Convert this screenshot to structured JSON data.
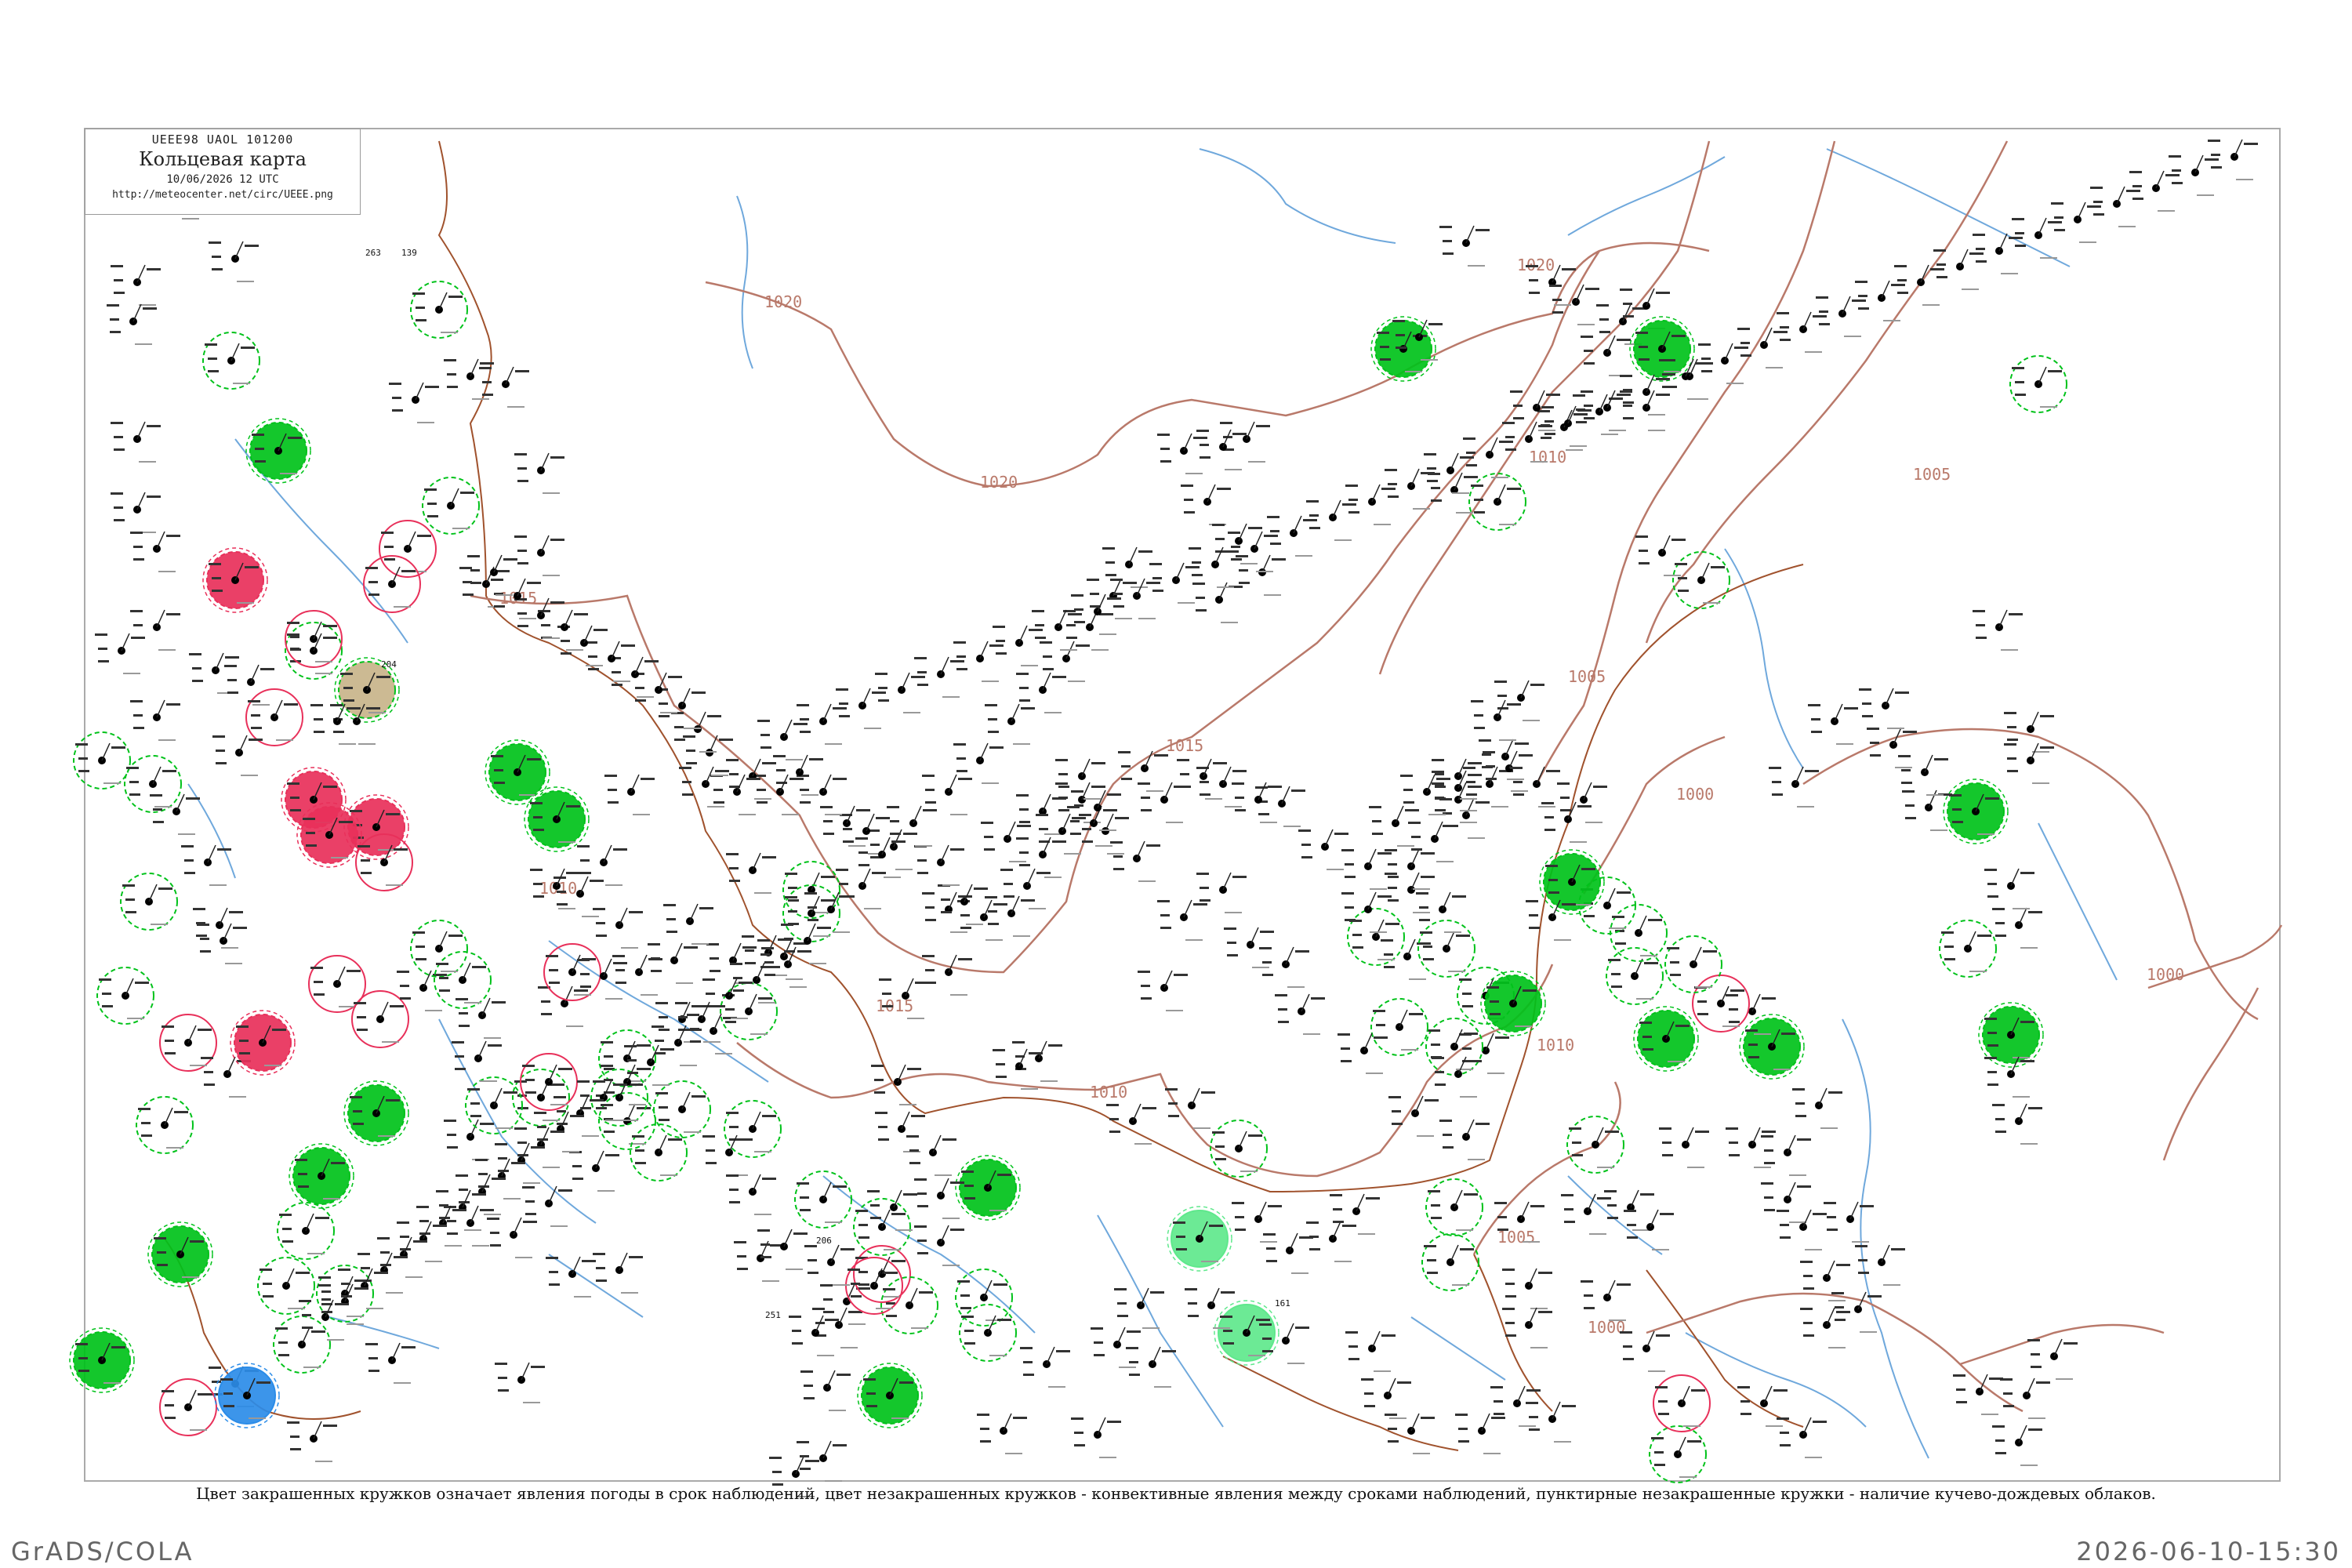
{
  "header": {
    "code": "UEEE98  UAOL  101200",
    "title": "Кольцевая карта",
    "time": "10/06/2026 12 UTC",
    "url": "http://meteocenter.net/circ/UEEE.png"
  },
  "isobar_labels": [
    "1020",
    "1020",
    "1020",
    "1015",
    "1015",
    "1015",
    "1010",
    "1010",
    "1010",
    "1010",
    "1005",
    "1005",
    "1005",
    "1000",
    "1000",
    "1000"
  ],
  "caption": "Цвет закрашенных кружков означает явления погоды в срок наблюдений, цвет незакрашенных кружков - конвективные явления между сроками наблюдений, пунктирные незакрашенные кружки - наличие кучево-дождевых облаков.",
  "footer": {
    "left": "GrADS/COLA",
    "right": "2026-06-10-15:30"
  },
  "colors": {
    "isobar": "#b9796a",
    "river": "#6fa8dc",
    "border": "#a0522d",
    "rain": "#00c21a",
    "light_rain": "#5fe88c",
    "thunderstorm": "#e8305a",
    "fog": "#c8b48a",
    "snow": "#2b8ce8"
  },
  "stations": [
    {
      "t": "263",
      "p": "139",
      "s": "filled-green-ring"
    },
    {
      "t": "204",
      "p": "",
      "s": "plain"
    },
    {
      "t": "206",
      "p": "",
      "s": "dashed-green"
    },
    {
      "t": "161",
      "p": "",
      "s": "filled-red"
    },
    {
      "t": "251",
      "p": "",
      "s": "plain"
    }
  ]
}
